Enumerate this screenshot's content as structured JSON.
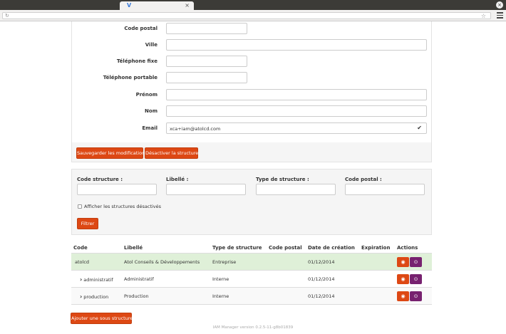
{
  "browser": {
    "tab_icon": "vee-icon",
    "close_glyph": "×",
    "url_icon_glyph": "↻",
    "star_glyph": "☆"
  },
  "form": {
    "fields": [
      {
        "label": "Code postal",
        "value": "",
        "width": "short"
      },
      {
        "label": "Ville",
        "value": "",
        "width": "long"
      },
      {
        "label": "Téléphone fixe",
        "value": "",
        "width": "short"
      },
      {
        "label": "Téléphone portable",
        "value": "",
        "width": "short"
      },
      {
        "label": "Prénom",
        "value": "",
        "width": "long"
      },
      {
        "label": "Nom",
        "value": "",
        "width": "long"
      },
      {
        "label": "Email",
        "value": "xca+iam@atolcd.com",
        "width": "long"
      }
    ],
    "save_label": "Sauvegarder les modifications",
    "deactivate_label": "Désactiver la structure"
  },
  "filter": {
    "code_label": "Code structure :",
    "libelle_label": "Libellé :",
    "type_label": "Type de structure :",
    "cp_label": "Code postal :",
    "show_disabled_label": "Afficher les structures désactivés",
    "filter_button": "Filtrer"
  },
  "table": {
    "headers": [
      "Code",
      "Libellé",
      "Type de structure",
      "Code postal",
      "Date de création",
      "Expiration",
      "Actions"
    ],
    "rows": [
      {
        "code": "atolcd",
        "libelle": "Atol Conseils & Développements",
        "type": "Entreprise",
        "cp": "",
        "date": "01/12/2014",
        "expiration": "",
        "child": false
      },
      {
        "code": "administratif",
        "libelle": "Administratif",
        "type": "Interne",
        "cp": "",
        "date": "01/12/2014",
        "expiration": "",
        "child": true
      },
      {
        "code": "production",
        "libelle": "Production",
        "type": "Interne",
        "cp": "",
        "date": "01/12/2014",
        "expiration": "",
        "child": true
      }
    ],
    "view_glyph": "◉",
    "off_glyph": "⊙"
  },
  "add_sub_label": "Ajouter une sous structure",
  "footer": "IAM Manager version 0.2.5-11-g8b01839",
  "colors": {
    "accent": "#dd4814",
    "aubergine": "#77216f",
    "highlight_row": "#dff0d8"
  }
}
